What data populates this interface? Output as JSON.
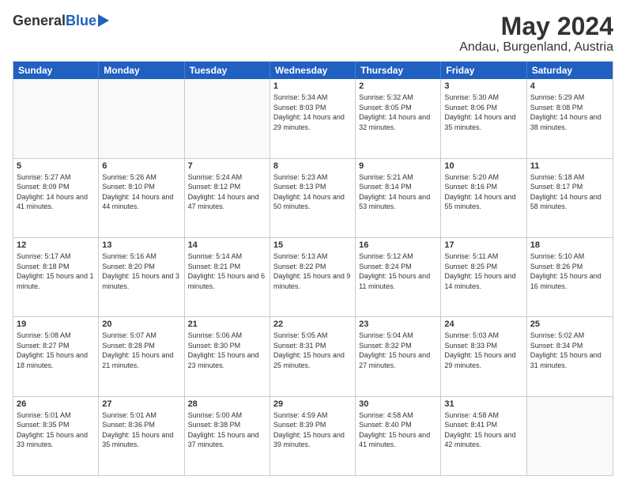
{
  "logo": {
    "general": "General",
    "blue": "Blue"
  },
  "title": {
    "month": "May 2024",
    "location": "Andau, Burgenland, Austria"
  },
  "weekdays": [
    "Sunday",
    "Monday",
    "Tuesday",
    "Wednesday",
    "Thursday",
    "Friday",
    "Saturday"
  ],
  "weeks": [
    [
      {
        "day": "",
        "sunrise": "",
        "sunset": "",
        "daylight": ""
      },
      {
        "day": "",
        "sunrise": "",
        "sunset": "",
        "daylight": ""
      },
      {
        "day": "",
        "sunrise": "",
        "sunset": "",
        "daylight": ""
      },
      {
        "day": "1",
        "sunrise": "Sunrise: 5:34 AM",
        "sunset": "Sunset: 8:03 PM",
        "daylight": "Daylight: 14 hours and 29 minutes."
      },
      {
        "day": "2",
        "sunrise": "Sunrise: 5:32 AM",
        "sunset": "Sunset: 8:05 PM",
        "daylight": "Daylight: 14 hours and 32 minutes."
      },
      {
        "day": "3",
        "sunrise": "Sunrise: 5:30 AM",
        "sunset": "Sunset: 8:06 PM",
        "daylight": "Daylight: 14 hours and 35 minutes."
      },
      {
        "day": "4",
        "sunrise": "Sunrise: 5:29 AM",
        "sunset": "Sunset: 8:08 PM",
        "daylight": "Daylight: 14 hours and 38 minutes."
      }
    ],
    [
      {
        "day": "5",
        "sunrise": "Sunrise: 5:27 AM",
        "sunset": "Sunset: 8:09 PM",
        "daylight": "Daylight: 14 hours and 41 minutes."
      },
      {
        "day": "6",
        "sunrise": "Sunrise: 5:26 AM",
        "sunset": "Sunset: 8:10 PM",
        "daylight": "Daylight: 14 hours and 44 minutes."
      },
      {
        "day": "7",
        "sunrise": "Sunrise: 5:24 AM",
        "sunset": "Sunset: 8:12 PM",
        "daylight": "Daylight: 14 hours and 47 minutes."
      },
      {
        "day": "8",
        "sunrise": "Sunrise: 5:23 AM",
        "sunset": "Sunset: 8:13 PM",
        "daylight": "Daylight: 14 hours and 50 minutes."
      },
      {
        "day": "9",
        "sunrise": "Sunrise: 5:21 AM",
        "sunset": "Sunset: 8:14 PM",
        "daylight": "Daylight: 14 hours and 53 minutes."
      },
      {
        "day": "10",
        "sunrise": "Sunrise: 5:20 AM",
        "sunset": "Sunset: 8:16 PM",
        "daylight": "Daylight: 14 hours and 55 minutes."
      },
      {
        "day": "11",
        "sunrise": "Sunrise: 5:18 AM",
        "sunset": "Sunset: 8:17 PM",
        "daylight": "Daylight: 14 hours and 58 minutes."
      }
    ],
    [
      {
        "day": "12",
        "sunrise": "Sunrise: 5:17 AM",
        "sunset": "Sunset: 8:18 PM",
        "daylight": "Daylight: 15 hours and 1 minute."
      },
      {
        "day": "13",
        "sunrise": "Sunrise: 5:16 AM",
        "sunset": "Sunset: 8:20 PM",
        "daylight": "Daylight: 15 hours and 3 minutes."
      },
      {
        "day": "14",
        "sunrise": "Sunrise: 5:14 AM",
        "sunset": "Sunset: 8:21 PM",
        "daylight": "Daylight: 15 hours and 6 minutes."
      },
      {
        "day": "15",
        "sunrise": "Sunrise: 5:13 AM",
        "sunset": "Sunset: 8:22 PM",
        "daylight": "Daylight: 15 hours and 9 minutes."
      },
      {
        "day": "16",
        "sunrise": "Sunrise: 5:12 AM",
        "sunset": "Sunset: 8:24 PM",
        "daylight": "Daylight: 15 hours and 11 minutes."
      },
      {
        "day": "17",
        "sunrise": "Sunrise: 5:11 AM",
        "sunset": "Sunset: 8:25 PM",
        "daylight": "Daylight: 15 hours and 14 minutes."
      },
      {
        "day": "18",
        "sunrise": "Sunrise: 5:10 AM",
        "sunset": "Sunset: 8:26 PM",
        "daylight": "Daylight: 15 hours and 16 minutes."
      }
    ],
    [
      {
        "day": "19",
        "sunrise": "Sunrise: 5:08 AM",
        "sunset": "Sunset: 8:27 PM",
        "daylight": "Daylight: 15 hours and 18 minutes."
      },
      {
        "day": "20",
        "sunrise": "Sunrise: 5:07 AM",
        "sunset": "Sunset: 8:28 PM",
        "daylight": "Daylight: 15 hours and 21 minutes."
      },
      {
        "day": "21",
        "sunrise": "Sunrise: 5:06 AM",
        "sunset": "Sunset: 8:30 PM",
        "daylight": "Daylight: 15 hours and 23 minutes."
      },
      {
        "day": "22",
        "sunrise": "Sunrise: 5:05 AM",
        "sunset": "Sunset: 8:31 PM",
        "daylight": "Daylight: 15 hours and 25 minutes."
      },
      {
        "day": "23",
        "sunrise": "Sunrise: 5:04 AM",
        "sunset": "Sunset: 8:32 PM",
        "daylight": "Daylight: 15 hours and 27 minutes."
      },
      {
        "day": "24",
        "sunrise": "Sunrise: 5:03 AM",
        "sunset": "Sunset: 8:33 PM",
        "daylight": "Daylight: 15 hours and 29 minutes."
      },
      {
        "day": "25",
        "sunrise": "Sunrise: 5:02 AM",
        "sunset": "Sunset: 8:34 PM",
        "daylight": "Daylight: 15 hours and 31 minutes."
      }
    ],
    [
      {
        "day": "26",
        "sunrise": "Sunrise: 5:01 AM",
        "sunset": "Sunset: 8:35 PM",
        "daylight": "Daylight: 15 hours and 33 minutes."
      },
      {
        "day": "27",
        "sunrise": "Sunrise: 5:01 AM",
        "sunset": "Sunset: 8:36 PM",
        "daylight": "Daylight: 15 hours and 35 minutes."
      },
      {
        "day": "28",
        "sunrise": "Sunrise: 5:00 AM",
        "sunset": "Sunset: 8:38 PM",
        "daylight": "Daylight: 15 hours and 37 minutes."
      },
      {
        "day": "29",
        "sunrise": "Sunrise: 4:59 AM",
        "sunset": "Sunset: 8:39 PM",
        "daylight": "Daylight: 15 hours and 39 minutes."
      },
      {
        "day": "30",
        "sunrise": "Sunrise: 4:58 AM",
        "sunset": "Sunset: 8:40 PM",
        "daylight": "Daylight: 15 hours and 41 minutes."
      },
      {
        "day": "31",
        "sunrise": "Sunrise: 4:58 AM",
        "sunset": "Sunset: 8:41 PM",
        "daylight": "Daylight: 15 hours and 42 minutes."
      },
      {
        "day": "",
        "sunrise": "",
        "sunset": "",
        "daylight": ""
      }
    ]
  ]
}
